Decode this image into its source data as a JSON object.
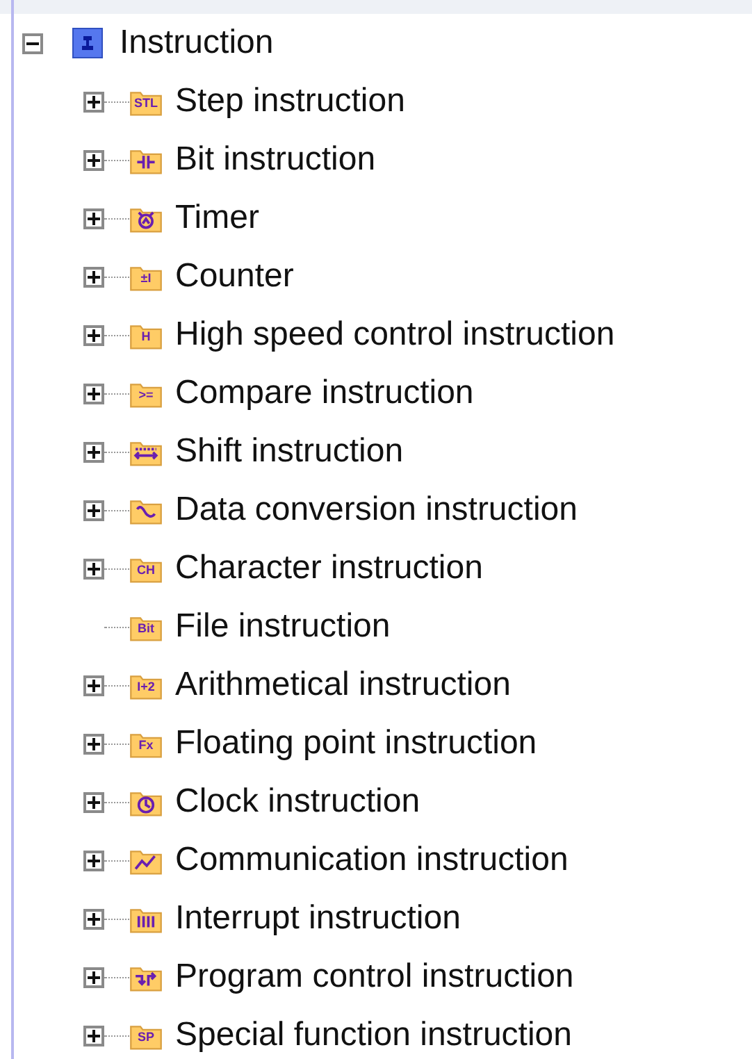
{
  "tree": {
    "label": "Instruction",
    "expanded": true,
    "children": [
      {
        "label": "Step instruction",
        "expanded": false,
        "icon_text": "STL"
      },
      {
        "label": "Bit instruction",
        "expanded": false,
        "kind": "contact"
      },
      {
        "label": "Timer",
        "expanded": false,
        "kind": "timer"
      },
      {
        "label": "Counter",
        "expanded": false,
        "icon_text": "±I"
      },
      {
        "label": "High speed control instruction",
        "expanded": false,
        "icon_text": "H"
      },
      {
        "label": "Compare instruction",
        "expanded": false,
        "icon_text": ">="
      },
      {
        "label": "Shift instruction",
        "expanded": false,
        "kind": "shift"
      },
      {
        "label": "Data conversion instruction",
        "expanded": false,
        "kind": "convert"
      },
      {
        "label": "Character instruction",
        "expanded": false,
        "icon_text": "CH"
      },
      {
        "label": "File instruction",
        "icon_text": "Bit"
      },
      {
        "label": "Arithmetical instruction",
        "expanded": false,
        "icon_text": "I+2"
      },
      {
        "label": "Floating point instruction",
        "expanded": false,
        "icon_text": "Fx"
      },
      {
        "label": "Clock instruction",
        "expanded": false,
        "kind": "clock"
      },
      {
        "label": "Communication instruction",
        "expanded": false,
        "kind": "chart"
      },
      {
        "label": "Interrupt instruction",
        "expanded": false,
        "kind": "interrupt"
      },
      {
        "label": "Program control instruction",
        "expanded": false,
        "kind": "jump"
      },
      {
        "label": "Special function instruction",
        "expanded": false,
        "icon_text": "SP"
      }
    ]
  }
}
